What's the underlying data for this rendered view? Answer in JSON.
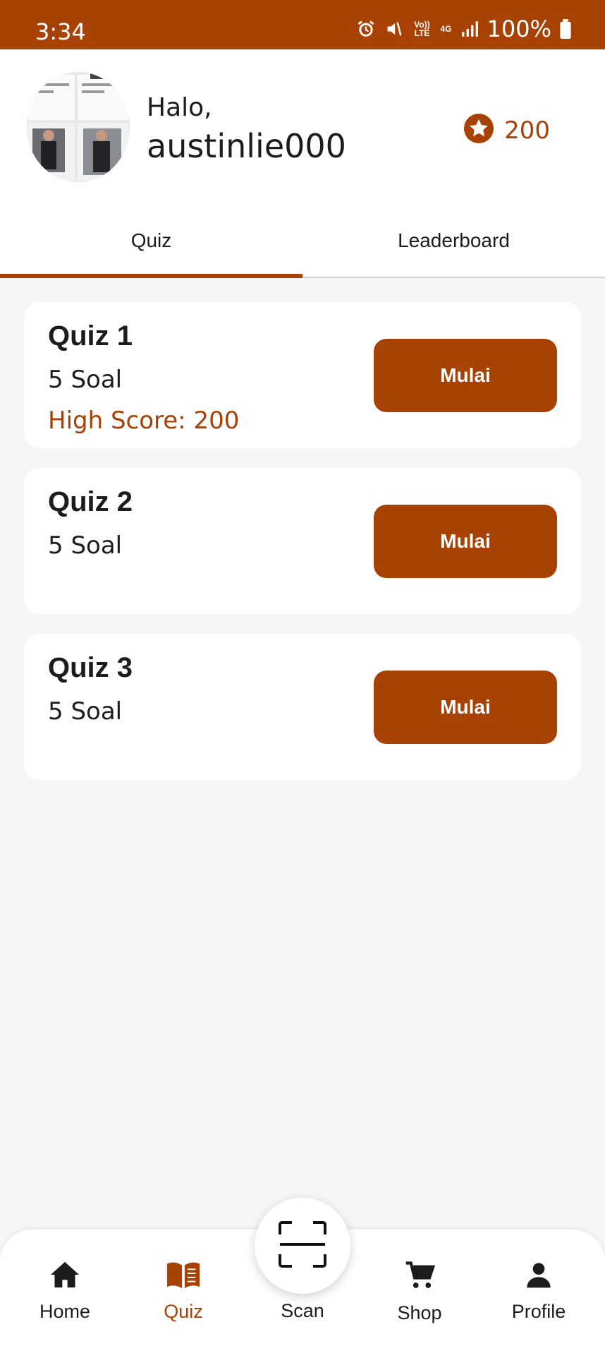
{
  "status_bar": {
    "time": "3:34",
    "volte": "Vo)) LTE",
    "network": "4G",
    "battery": "100%"
  },
  "header": {
    "greeting": "Halo,",
    "username": "austinlie000",
    "points": "200",
    "points_icon": "star-badge-icon"
  },
  "tabs": [
    {
      "label": "Quiz",
      "active": true
    },
    {
      "label": "Leaderboard",
      "active": false
    }
  ],
  "quizzes": [
    {
      "title": "Quiz 1",
      "count": "5 Soal",
      "high_score": "High Score: 200",
      "button": "Mulai"
    },
    {
      "title": "Quiz 2",
      "count": "5 Soal",
      "high_score": "",
      "button": "Mulai"
    },
    {
      "title": "Quiz 3",
      "count": "5 Soal",
      "high_score": "",
      "button": "Mulai"
    }
  ],
  "bottom_nav": {
    "home": "Home",
    "quiz": "Quiz",
    "scan": "Scan",
    "shop": "Shop",
    "profile": "Profile",
    "active": "quiz"
  },
  "colors": {
    "accent": "#a84104",
    "background": "#f5f6f8",
    "card": "#ffffff",
    "text": "#1c1c1c"
  }
}
